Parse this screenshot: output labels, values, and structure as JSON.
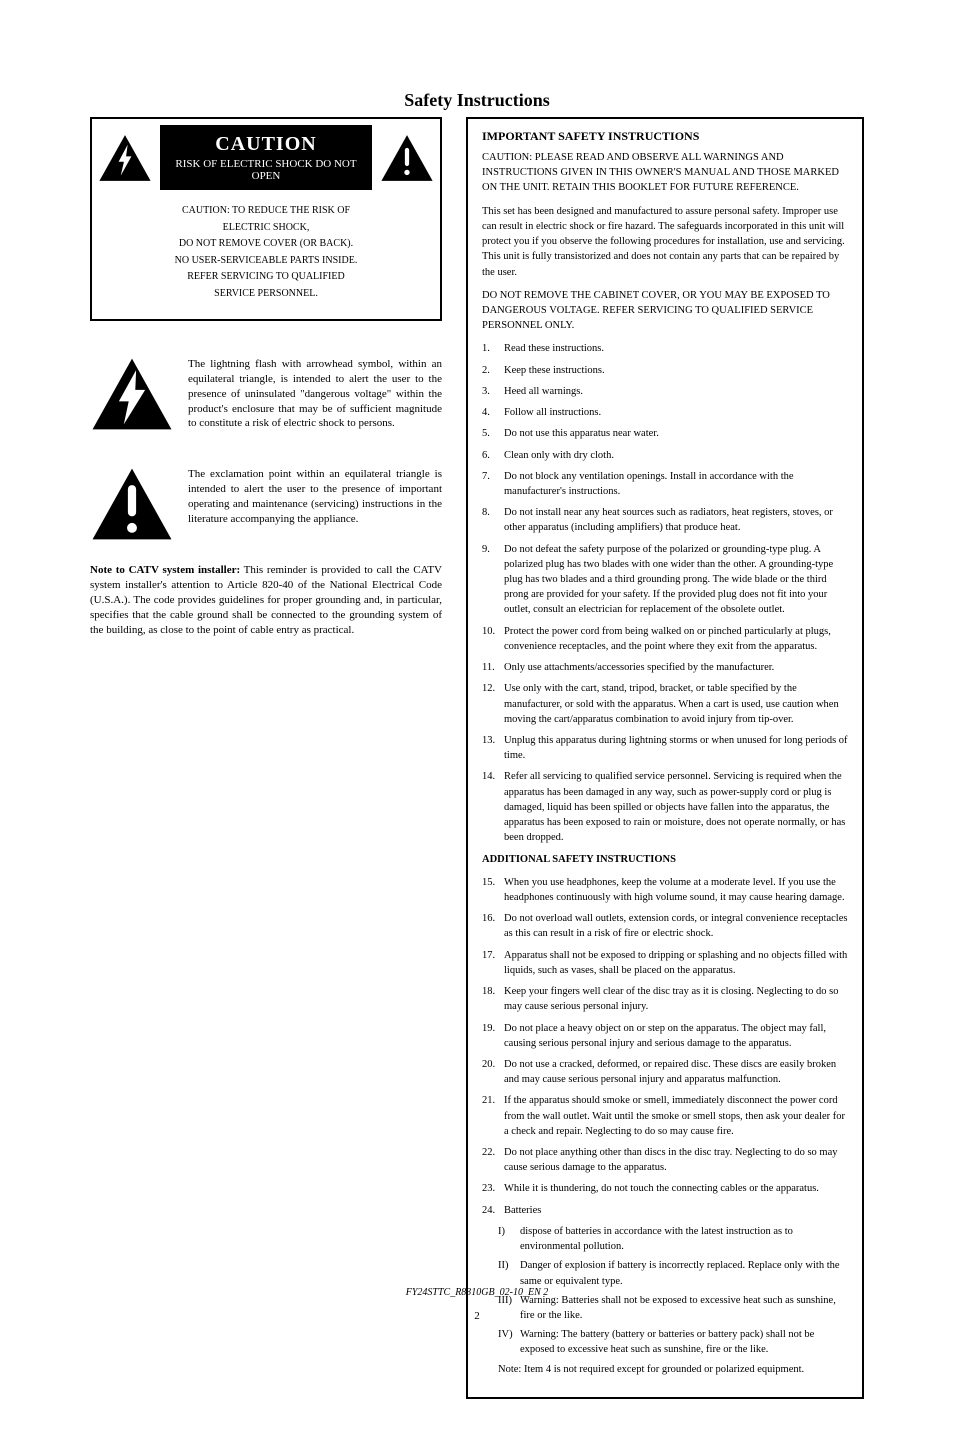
{
  "heading": "Safety Instructions",
  "caution": {
    "title": "CAUTION",
    "subtitle": "RISK OF ELECTRIC SHOCK DO NOT OPEN",
    "body": [
      "CAUTION: TO REDUCE THE RISK OF",
      "ELECTRIC SHOCK,",
      "DO NOT REMOVE COVER (OR BACK).",
      "NO USER-SERVICEABLE PARTS INSIDE.",
      "REFER SERVICING TO QUALIFIED",
      "SERVICE PERSONNEL."
    ]
  },
  "left": {
    "bolt": "The lightning flash with arrowhead symbol, within an equilateral triangle, is intended to alert the user to the presence of uninsulated \"dangerous voltage\" within the product's enclosure that may be of sufficient magnitude to constitute a risk of electric shock to persons.",
    "excl": "The exclamation point within an equilateral triangle is intended to alert the user to the presence of important operating and maintenance (servicing) instructions in the literature accompanying the appliance."
  },
  "note": {
    "label": "Note to CATV system installer:",
    "text": " This reminder is provided to call the CATV system installer's attention to Article 820-40 of the National Electrical Code (U.S.A.). The code provides guidelines for proper grounding and, in particular, specifies that the cable ground shall be connected to the grounding system of the building, as close to the point of cable entry as practical."
  },
  "right": {
    "title": "IMPORTANT SAFETY INSTRUCTIONS",
    "caution": "CAUTION: PLEASE READ AND OBSERVE ALL WARNINGS AND INSTRUCTIONS GIVEN IN THIS OWNER'S MANUAL AND THOSE MARKED ON THE UNIT. RETAIN THIS BOOKLET FOR FUTURE REFERENCE.",
    "intro": "This set has been designed and manufactured to assure personal safety. Improper use can result in electric shock or fire hazard. The safeguards incorporated in this unit will protect you if you observe the following procedures for installation, use and servicing. This unit is fully transistorized and does not contain any parts that can be repaired by the user.",
    "disassemble": "DO NOT REMOVE THE CABINET COVER, OR YOU MAY BE EXPOSED TO DANGEROUS VOLTAGE. REFER SERVICING TO QUALIFIED SERVICE PERSONNEL ONLY.",
    "item1": {
      "n": "1.",
      "t": "Read these instructions."
    },
    "item2": {
      "n": "2.",
      "t": "Keep these instructions."
    },
    "item3": {
      "n": "3.",
      "t": "Heed all warnings."
    },
    "item4": {
      "n": "4.",
      "t": "Follow all instructions."
    },
    "item5": {
      "n": "5.",
      "t": "Do not use this apparatus near water."
    },
    "item6": {
      "n": "6.",
      "t": "Clean only with dry cloth."
    },
    "item7": {
      "n": "7.",
      "t": "Do not block any ventilation openings. Install in accordance with the manufacturer's instructions."
    },
    "item8": {
      "n": "8.",
      "t": "Do not install near any heat sources such as radiators, heat registers, stoves, or other apparatus (including amplifiers) that produce heat."
    },
    "item9": {
      "n": "9.",
      "t": "Do not defeat the safety purpose of the polarized or grounding-type plug. A polarized plug has two blades with one wider than the other. A grounding-type plug has two blades and a third grounding prong. The wide blade or the third prong are provided for your safety. If the provided plug does not fit into your outlet, consult an electrician for replacement of the obsolete outlet."
    },
    "item10": {
      "n": "10.",
      "t": "Protect the power cord from being walked on or pinched particularly at plugs, convenience receptacles, and the point where they exit from the apparatus."
    },
    "item11": {
      "n": "11.",
      "t": "Only use attachments/accessories specified by the manufacturer."
    },
    "item12": {
      "n": "12.",
      "t": "Use only with the cart, stand, tripod, bracket, or table specified by the manufacturer, or sold with the apparatus. When a cart is used, use caution when moving the cart/apparatus combination to avoid injury from tip-over."
    },
    "item13": {
      "n": "13.",
      "t": "Unplug this apparatus during lightning storms or when unused for long periods of time."
    },
    "item14": {
      "n": "14.",
      "t": "Refer all servicing to qualified service personnel. Servicing is required when the apparatus has been damaged in any way, such as power-supply cord or plug is damaged, liquid has been spilled or objects have fallen into the apparatus, the apparatus has been exposed to rain or moisture, does not operate normally, or has been dropped."
    },
    "addl": "ADDITIONAL SAFETY INSTRUCTIONS",
    "item15": {
      "n": "15.",
      "t": "When you use headphones, keep the volume at a moderate level. If you use the headphones continuously with high volume sound, it may cause hearing damage."
    },
    "item16": {
      "n": "16.",
      "t": "Do not overload wall outlets, extension cords, or integral convenience receptacles as this can result in a risk of fire or electric shock."
    },
    "item17": {
      "n": "17.",
      "t": "Apparatus shall not be exposed to dripping or splashing and no objects filled with liquids, such as vases, shall be placed on the apparatus."
    },
    "item18": {
      "n": "18.",
      "t": "Keep your fingers well clear of the disc tray as it is closing. Neglecting to do so may cause serious personal injury."
    },
    "item19": {
      "n": "19.",
      "t": "Do not place a heavy object on or step on the apparatus. The object may fall, causing serious personal injury and serious damage to the apparatus."
    },
    "item20": {
      "n": "20.",
      "t": "Do not use a cracked, deformed, or repaired disc. These discs are easily broken and may cause serious personal injury and apparatus malfunction."
    },
    "item21": {
      "n": "21.",
      "t": "If the apparatus should smoke or smell, immediately disconnect the power cord from the wall outlet. Wait until the smoke or smell stops, then ask your dealer for a check and repair. Neglecting to do so may cause fire."
    },
    "item22": {
      "n": "22.",
      "t": "Do not place anything other than discs in the disc tray. Neglecting to do so may cause serious damage to the apparatus."
    },
    "item23": {
      "n": "23.",
      "t": "While it is thundering, do not touch the connecting cables or the apparatus."
    },
    "item24": {
      "n": "24.",
      "t": "Batteries"
    },
    "sub24a": {
      "n": "I)",
      "t": "dispose of batteries in accordance with the latest instruction as to environmental pollution."
    },
    "sub24b": {
      "n": "II)",
      "t": "Danger of explosion if battery is incorrectly replaced. Replace only with the same or equivalent type."
    },
    "sub24c": {
      "n": "III)",
      "t": "Warning: Batteries shall not be exposed to excessive heat such as sunshine, fire or the like."
    },
    "sub24d": {
      "n": "IV)",
      "t": "Warning: The battery (battery or batteries or battery pack) shall not be exposed to excessive heat such as sunshine, fire or the like."
    },
    "note4": "Note: Item 4 is not required except for grounded or polarized equipment."
  },
  "footer": {
    "title": "FY24STTC_R8310GB_02-10_EN  2",
    "page": "2"
  }
}
